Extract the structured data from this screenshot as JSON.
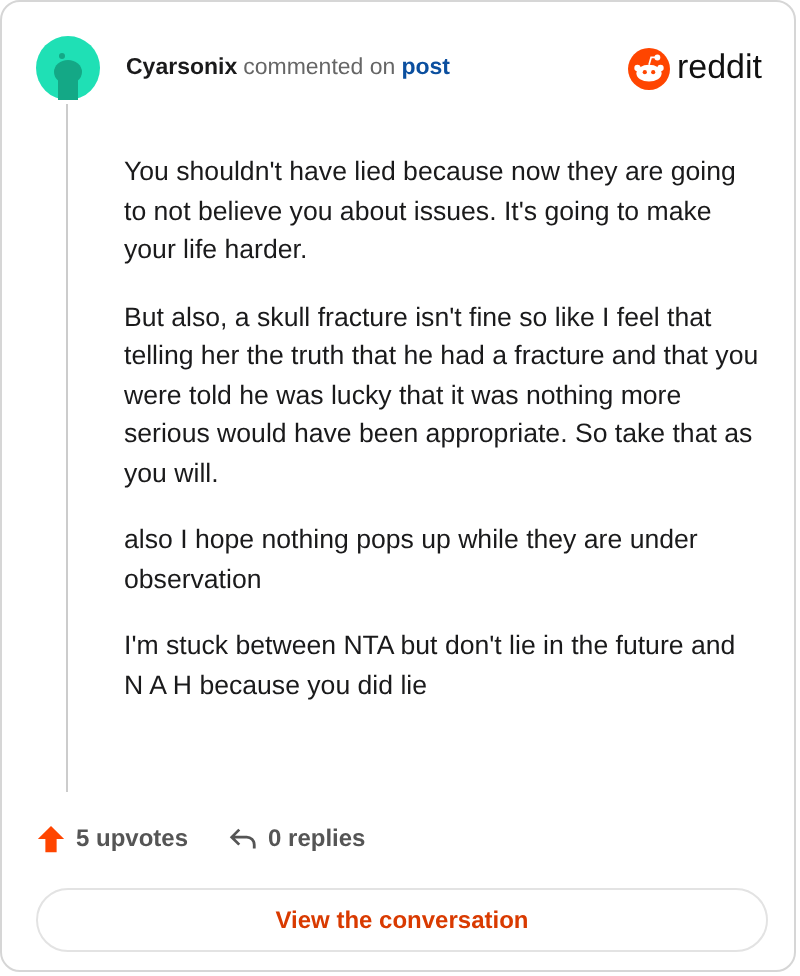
{
  "comment": {
    "author": "Cyarsonix",
    "action": "commented on",
    "target": "post",
    "brand": "reddit",
    "paragraphs": [
      "You shouldn't have lied because now they are going to not believe you about issues. It's going to make your life harder.",
      "But also, a skull fracture isn't fine so like I feel that telling her the truth that he had a fracture and that you were told he was lucky that it was nothing more serious would have been appropriate. So take that as you will.",
      "also I hope nothing pops up while they are under observation",
      "I'm stuck between NTA but don't lie in the future and N A H because you did lie"
    ],
    "upvotes": "5 upvotes",
    "replies": "0 replies"
  },
  "button": "View the conversation"
}
